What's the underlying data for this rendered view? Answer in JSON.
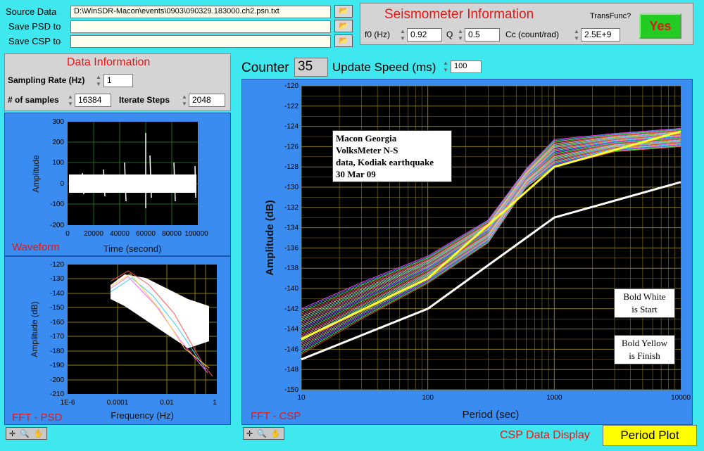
{
  "files": {
    "source_label": "Source Data",
    "source_value": "D:\\WinSDR-Macon\\events\\0903\\090329.183000.ch2.psn.txt",
    "psd_label": "Save PSD to",
    "psd_value": "",
    "csp_label": "Save CSP to",
    "csp_value": ""
  },
  "seismometer": {
    "title": "Seismometer Information",
    "f0_label": "f0 (Hz)",
    "f0_value": "0.92",
    "q_label": "Q",
    "q_value": "0.5",
    "cc_label": "Cc (count/rad)",
    "cc_value": "2.5E+9",
    "transfunc_label": "TransFunc?",
    "transfunc_value": "Yes"
  },
  "data_info": {
    "title": "Data Information",
    "rate_label": "Sampling Rate (Hz)",
    "rate_value": "1",
    "samples_label": "# of samples",
    "samples_value": "16384",
    "iterate_label": "Iterate Steps",
    "iterate_value": "2048"
  },
  "counter": {
    "label": "Counter",
    "value": "35"
  },
  "speed": {
    "label": "Update Speed (ms)",
    "value": "100"
  },
  "waveform": {
    "caption": "Waveform",
    "ylabel": "Amplitude",
    "xlabel": "Time (second)",
    "yticks": [
      "300",
      "200",
      "100",
      "0",
      "-100",
      "-200"
    ],
    "xticks": [
      "0",
      "20000",
      "40000",
      "60000",
      "80000",
      "100000"
    ]
  },
  "psd": {
    "caption": "FFT - PSD",
    "ylabel": "Amplitude (dB)",
    "xlabel": "Frequency (Hz)",
    "yticks": [
      "-120",
      "-130",
      "-140",
      "-150",
      "-160",
      "-170",
      "-180",
      "-190",
      "-200",
      "-210"
    ],
    "xticks": [
      "1E-6",
      "0.0001",
      "0.01",
      "1"
    ]
  },
  "csp": {
    "caption": "FFT - CSP",
    "ylabel": "Amplitude (dB)",
    "xlabel": "Period (sec)",
    "yticks": [
      "-120",
      "-122",
      "-124",
      "-126",
      "-128",
      "-130",
      "-132",
      "-134",
      "-136",
      "-138",
      "-140",
      "-142",
      "-144",
      "-146",
      "-148",
      "-150"
    ],
    "xticks": [
      "10",
      "100",
      "1000",
      "10000"
    ],
    "note1": [
      "Macon Georgia",
      "VolksMeter N-S",
      "data, Kodiak earthquake",
      "30 Mar 09"
    ],
    "note2": [
      "Bold White",
      "is Start"
    ],
    "note3": [
      "Bold Yellow",
      "is Finish"
    ]
  },
  "display": {
    "label": "CSP Data Display",
    "value": "Period Plot"
  },
  "chart_data": {
    "type": "line",
    "title": "",
    "xlabel": "Period (sec)",
    "ylabel": "Amplitude (dB)",
    "xscale": "log",
    "xlim": [
      10,
      10000
    ],
    "ylim": [
      -150,
      -120
    ],
    "series": [
      {
        "color": "#ffffff",
        "x": [
          10,
          100,
          1000,
          10000
        ],
        "y": [
          -147,
          -142,
          -133,
          -129.5
        ]
      },
      {
        "color": "#ffff33",
        "x": [
          10,
          100,
          1000,
          10000
        ],
        "y": [
          -145,
          -139,
          -128,
          -124.5
        ]
      }
    ]
  }
}
